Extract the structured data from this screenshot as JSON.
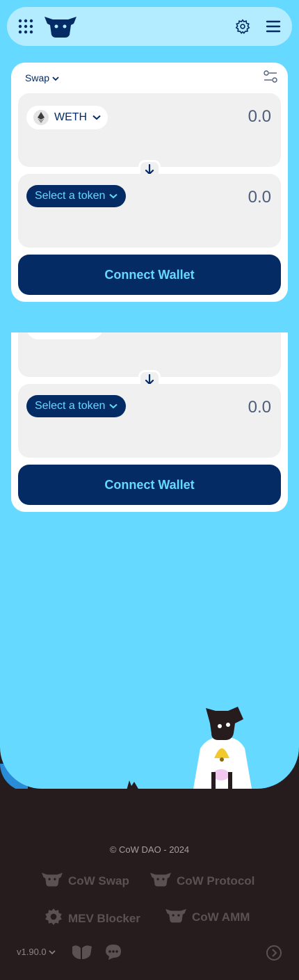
{
  "header": {
    "apps_icon": "grid-icon",
    "logo_icon": "cow-logo-icon",
    "settings_icon": "gear-icon",
    "menu_icon": "hamburger-icon"
  },
  "swap": {
    "mode_label": "Swap",
    "sell": {
      "token": "WETH",
      "amount": "0.0"
    },
    "buy": {
      "token_placeholder": "Select a token",
      "amount": "0.0"
    },
    "connect_label": "Connect Wallet"
  },
  "swap_repeat": {
    "buy": {
      "token_placeholder": "Select a token",
      "amount": "0.0"
    },
    "connect_label": "Connect Wallet"
  },
  "footer": {
    "copyright": "© CoW DAO - 2024",
    "links": [
      {
        "label": "CoW Swap",
        "icon": "cow-icon"
      },
      {
        "label": "CoW Protocol",
        "icon": "cow-icon"
      },
      {
        "label": "MEV Blocker",
        "icon": "gear-icon"
      },
      {
        "label": "CoW AMM",
        "icon": "cow-icon"
      }
    ],
    "version": "v1.90.0",
    "social_icons": [
      "farcaster-icon",
      "chat-icon"
    ],
    "next_icon": "chevron-right-circle-icon"
  },
  "colors": {
    "background": "#65d9ff",
    "header_bg": "#b3ebff",
    "primary": "#052b65",
    "footer_bg": "#261c1d",
    "panel_bg": "#f0f0f0"
  }
}
